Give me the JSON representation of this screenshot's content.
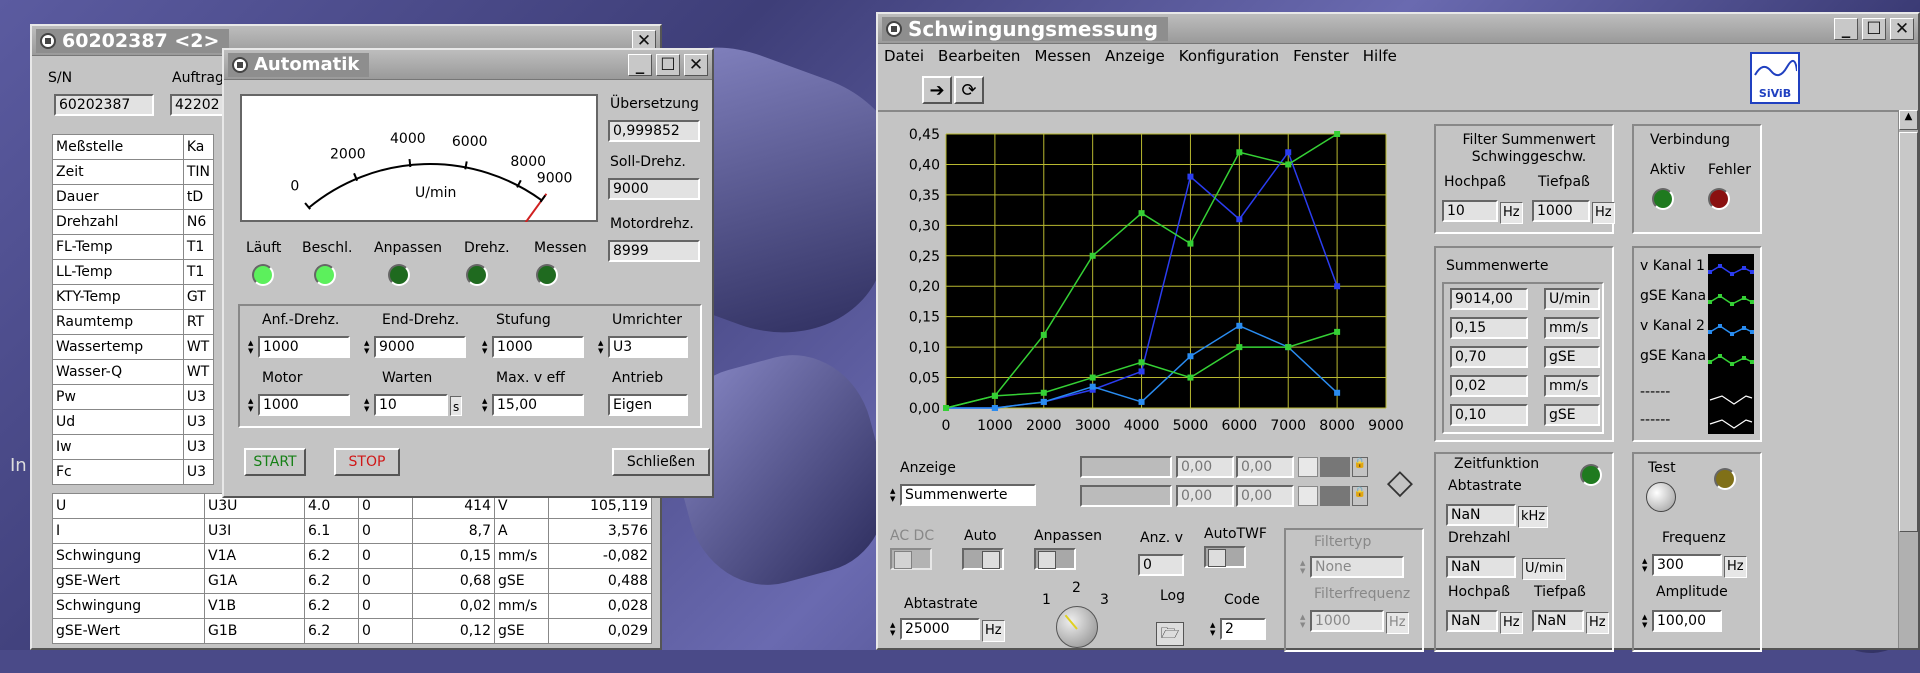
{
  "desktop": {
    "left_text": "In"
  },
  "win_table": {
    "title": "60202387 <2>",
    "sn_label": "S/N",
    "sn_value": "60202387",
    "auftrag_label": "Auftrag",
    "auftrag_value": "42202",
    "header": [
      "Meßstelle",
      "Ka"
    ],
    "rows": [
      [
        "Zeit",
        "TIN"
      ],
      [
        "Dauer",
        "tD"
      ],
      [
        "Drehzahl",
        "N6"
      ],
      [
        "FL-Temp",
        "T1"
      ],
      [
        "LL-Temp",
        "T1"
      ],
      [
        "KTY-Temp",
        "GT"
      ],
      [
        "Raumtemp",
        "RT"
      ],
      [
        "Wassertemp",
        "WT"
      ],
      [
        "Wasser-Q",
        "WT"
      ],
      [
        "Pw",
        "U3"
      ],
      [
        "Ud",
        "U3"
      ],
      [
        "Iw",
        "U3"
      ],
      [
        "Fc",
        "U3"
      ]
    ],
    "full_rows": [
      [
        "U",
        "U3U",
        "4.0",
        "0",
        "414",
        "V",
        "105,119"
      ],
      [
        "I",
        "U3I",
        "6.1",
        "0",
        "8,7",
        "A",
        "3,576"
      ],
      [
        "Schwingung",
        "V1A",
        "6.2",
        "0",
        "0,15",
        "mm/s",
        "-0,082"
      ],
      [
        "gSE-Wert",
        "G1A",
        "6.2",
        "0",
        "0,68",
        "gSE",
        "0,488"
      ],
      [
        "Schwingung",
        "V1B",
        "6.2",
        "0",
        "0,02",
        "mm/s",
        "0,028"
      ],
      [
        "gSE-Wert",
        "G1B",
        "6.2",
        "0",
        "0,12",
        "gSE",
        "0,029"
      ]
    ]
  },
  "win_auto": {
    "title": "Automatik",
    "gauge": {
      "ticks": [
        "0",
        "2000",
        "4000",
        "6000",
        "8000",
        "9000"
      ],
      "unit": "U/min",
      "needle_value": 9000,
      "max": 9000
    },
    "uebersetzung_label": "Übersetzung",
    "uebersetzung": "0,999852",
    "soll_label": "Soll-Drehz.",
    "soll": "9000",
    "motor_label": "Motordrehz.",
    "motor": "8999",
    "leds": [
      {
        "label": "Läuft",
        "color": "#5cf05c"
      },
      {
        "label": "Beschl.",
        "color": "#5cf05c"
      },
      {
        "label": "Anpassen",
        "color": "#1f6a1f"
      },
      {
        "label": "Drehz.",
        "color": "#1f6a1f"
      },
      {
        "label": "Messen",
        "color": "#1f6a1f"
      }
    ],
    "anf_label": "Anf.-Drehz.",
    "anf": "1000",
    "end_label": "End-Drehz.",
    "end": "9000",
    "stuf_label": "Stufung",
    "stuf": "1000",
    "umr_label": "Umrichter",
    "umr": "U3",
    "motor2_label": "Motor",
    "motor2": "1000",
    "warten_label": "Warten",
    "warten": "10",
    "warten_unit": "s",
    "maxv_label": "Max. v eff",
    "maxv": "15,00",
    "antrieb_label": "Antrieb",
    "antrieb": "Eigen",
    "start": "START",
    "stop": "STOP",
    "close": "Schließen"
  },
  "win_schw": {
    "title": "Schwingungsmessung",
    "menu": [
      "Datei",
      "Bearbeiten",
      "Messen",
      "Anzeige",
      "Konfiguration",
      "Fenster",
      "Hilfe"
    ],
    "logo": "SiViB",
    "filter": {
      "title": "Filter Summenwert Schwinggeschw.",
      "hp_label": "Hochpaß",
      "tp_label": "Tiefpaß",
      "hp": "10",
      "hp_unit": "Hz",
      "tp": "1000",
      "tp_unit": "Hz"
    },
    "verbindung": {
      "title": "Verbindung",
      "aktiv": "Aktiv",
      "fehler": "Fehler"
    },
    "summen": {
      "title": "Summenwerte",
      "values": [
        "9014,00",
        "0,15",
        "0,70",
        "0,02",
        "0,10"
      ],
      "units": [
        "U/min",
        "mm/s",
        "gSE",
        "mm/s",
        "gSE"
      ]
    },
    "legend": [
      "v Kanal 1",
      "gSE Kanal",
      "v Kanal 2",
      "gSE Kanal",
      "------",
      "------"
    ],
    "anzeige_label": "Anzeige",
    "anzeige": "Summenwerte",
    "cursor_row1": [
      "0,00",
      "0,00"
    ],
    "cursor_row2": [
      "0,00",
      "0,00"
    ],
    "acdc": "AC DC",
    "auto": "Auto",
    "anpassen": "Anpassen",
    "anzv": "Anz. v",
    "anzv_val": "0",
    "autotwf": "AutoTWF",
    "filtertyp_label": "Filtertyp",
    "filtertyp": "None",
    "filterfreq_label": "Filterfrequenz",
    "filterfreq": "1000",
    "filterfreq_unit": "Hz",
    "abtast_label": "Abtastrate",
    "abtast": "25000",
    "abtast_unit": "Hz",
    "knob": [
      "1",
      "2",
      "3"
    ],
    "log": "Log",
    "code_label": "Code",
    "code": "2",
    "zeit": {
      "title": "Zeitfunktion",
      "abtast_label": "Abtastrate",
      "abtast": "NaN",
      "abtast_unit": "kHz",
      "dreh_label": "Drehzahl",
      "dreh": "NaN",
      "dreh_unit": "U/min",
      "hp_label": "Hochpaß",
      "tp_label": "Tiefpaß",
      "hp": "NaN",
      "hp_unit": "Hz",
      "tp": "NaN",
      "tp_unit": "Hz"
    },
    "test": {
      "title": "Test",
      "freq_label": "Frequenz",
      "freq": "300",
      "freq_unit": "Hz",
      "amp_label": "Amplitude",
      "amp": "100,00"
    }
  },
  "chart_data": {
    "type": "line",
    "x": [
      0,
      1000,
      2000,
      3000,
      4000,
      5000,
      6000,
      7000,
      8000
    ],
    "xlim": [
      0,
      9000
    ],
    "ylim": [
      0,
      0.45
    ],
    "xticks": [
      "0",
      "1000",
      "2000",
      "3000",
      "4000",
      "5000",
      "6000",
      "7000",
      "8000",
      "9000"
    ],
    "yticks": [
      "0,00",
      "0,05",
      "0,10",
      "0,15",
      "0,20",
      "0,25",
      "0,30",
      "0,35",
      "0,40",
      "0,45"
    ],
    "series": [
      {
        "name": "v Kanal 1",
        "color": "#2b3df0",
        "values": [
          0,
          0,
          0.01,
          0.03,
          0.06,
          0.38,
          0.31,
          0.42,
          0.2
        ]
      },
      {
        "name": "gSE Kanal",
        "color": "#35d035",
        "values": [
          0,
          0.02,
          0.12,
          0.25,
          0.32,
          0.27,
          0.42,
          0.4,
          0.45
        ]
      },
      {
        "name": "v Kanal 2",
        "color": "#2a8cf0",
        "values": [
          0,
          0,
          0.01,
          0.035,
          0.01,
          0.085,
          0.135,
          0.1,
          0.025
        ]
      },
      {
        "name": "gSE Kanal",
        "color": "#35d035",
        "values": [
          0,
          0.02,
          0.025,
          0.05,
          0.075,
          0.05,
          0.1,
          0.1,
          0.125
        ]
      }
    ],
    "grid": true
  }
}
